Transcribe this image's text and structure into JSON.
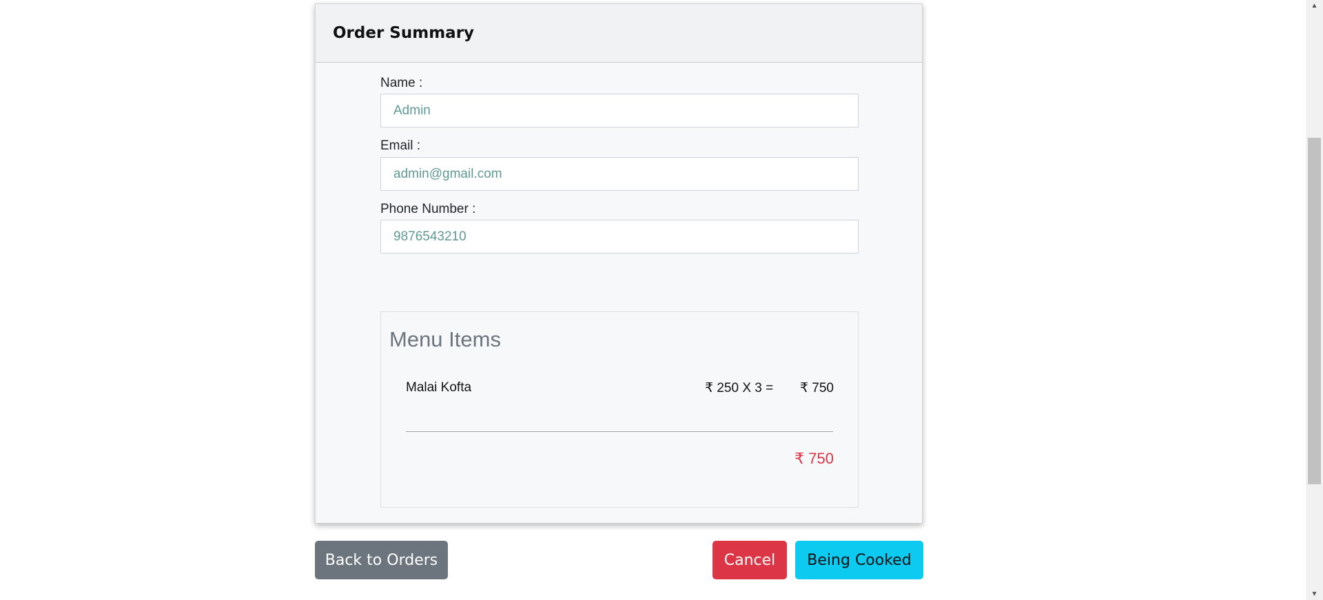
{
  "card": {
    "title": "Order Summary"
  },
  "form": {
    "name_label": "Name :",
    "name_value": "Admin",
    "email_label": "Email :",
    "email_value": "admin@gmail.com",
    "phone_label": "Phone Number :",
    "phone_value": "9876543210"
  },
  "menu": {
    "title": "Menu Items",
    "items": [
      {
        "name": "Malai Kofta",
        "calc": "₹ 250 X 3 =",
        "total": "₹ 750"
      }
    ],
    "grand_total": "₹ 750"
  },
  "actions": {
    "back_label": "Back to Orders",
    "cancel_label": "Cancel",
    "cooked_label": "Being Cooked"
  },
  "colors": {
    "primary_danger": "#dc3545",
    "info": "#0dcaf0",
    "secondary": "#6c757d"
  }
}
